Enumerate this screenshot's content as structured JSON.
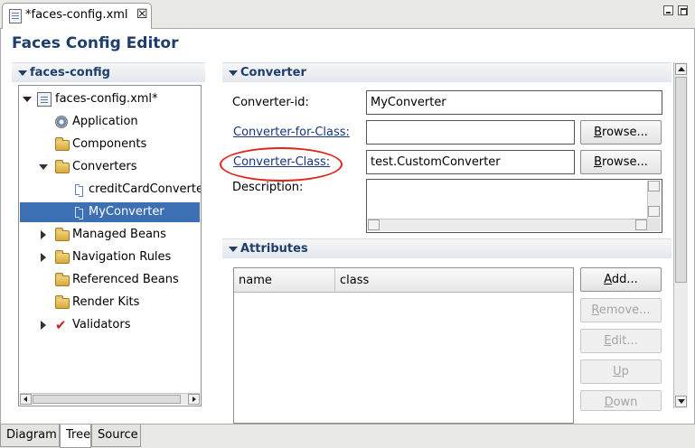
{
  "editor_tab": {
    "title": "*faces-config.xml",
    "close_glyph": "☒"
  },
  "editor": {
    "title": "Faces Config Editor"
  },
  "tree_section": {
    "title": "faces-config",
    "items": [
      {
        "label": "faces-config.xml*",
        "icon": "xml-file-icon"
      },
      {
        "label": "Application",
        "icon": "gear-icon"
      },
      {
        "label": "Components",
        "icon": "folder-icon"
      },
      {
        "label": "Converters",
        "icon": "folder-icon"
      },
      {
        "label": "creditCardConverter",
        "icon": "converter-icon"
      },
      {
        "label": "MyConverter",
        "icon": "converter-icon"
      },
      {
        "label": "Managed Beans",
        "icon": "folder-icon"
      },
      {
        "label": "Navigation Rules",
        "icon": "folder-icon"
      },
      {
        "label": "Referenced Beans",
        "icon": "folder-icon"
      },
      {
        "label": "Render Kits",
        "icon": "folder-icon"
      },
      {
        "label": "Validators",
        "icon": "checkmark-icon"
      }
    ]
  },
  "converter_section": {
    "title": "Converter",
    "id_label": "Converter-id:",
    "id_value": "MyConverter",
    "for_class_label": "Converter-for-Class:",
    "for_class_value": "",
    "class_label": "Converter-Class:",
    "class_value": "test.CustomConverter",
    "description_label": "Description:",
    "description_value": "",
    "browse_label_prefix": "B",
    "browse_label_rest": "rowse...",
    "highlight_color": "#e0241b"
  },
  "attributes_section": {
    "title": "Attributes",
    "columns": [
      "name",
      "class"
    ],
    "buttons": {
      "add_prefix": "A",
      "add_rest": "dd...",
      "remove_prefix": "R",
      "remove_rest": "emove...",
      "edit_prefix": "E",
      "edit_rest": "dit...",
      "up_prefix": "U",
      "up_rest": "p",
      "down_prefix": "D",
      "down_rest": "own"
    }
  },
  "page_tabs": [
    "Diagram",
    "Tree",
    "Source"
  ],
  "active_page_tab": "Tree",
  "colors": {
    "title": "#1d3e6c",
    "selection": "#3d6fb3",
    "link": "#17347f"
  }
}
